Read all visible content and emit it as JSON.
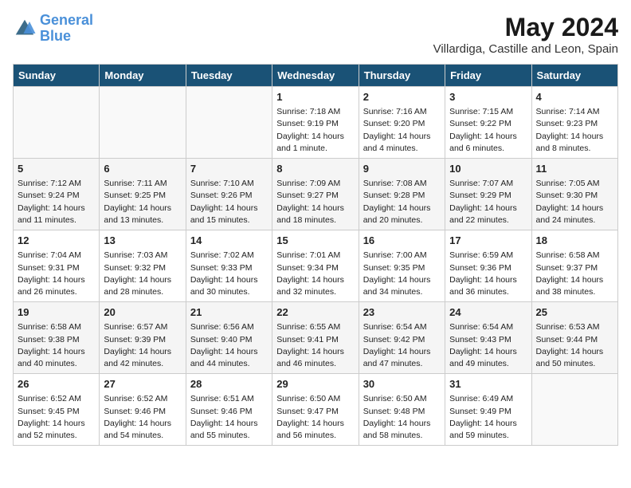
{
  "header": {
    "logo_line1": "General",
    "logo_line2": "Blue",
    "month": "May 2024",
    "location": "Villardiga, Castille and Leon, Spain"
  },
  "columns": [
    "Sunday",
    "Monday",
    "Tuesday",
    "Wednesday",
    "Thursday",
    "Friday",
    "Saturday"
  ],
  "weeks": [
    [
      {
        "day": "",
        "sunrise": "",
        "sunset": "",
        "daylight": ""
      },
      {
        "day": "",
        "sunrise": "",
        "sunset": "",
        "daylight": ""
      },
      {
        "day": "",
        "sunrise": "",
        "sunset": "",
        "daylight": ""
      },
      {
        "day": "1",
        "sunrise": "Sunrise: 7:18 AM",
        "sunset": "Sunset: 9:19 PM",
        "daylight": "Daylight: 14 hours and 1 minute."
      },
      {
        "day": "2",
        "sunrise": "Sunrise: 7:16 AM",
        "sunset": "Sunset: 9:20 PM",
        "daylight": "Daylight: 14 hours and 4 minutes."
      },
      {
        "day": "3",
        "sunrise": "Sunrise: 7:15 AM",
        "sunset": "Sunset: 9:22 PM",
        "daylight": "Daylight: 14 hours and 6 minutes."
      },
      {
        "day": "4",
        "sunrise": "Sunrise: 7:14 AM",
        "sunset": "Sunset: 9:23 PM",
        "daylight": "Daylight: 14 hours and 8 minutes."
      }
    ],
    [
      {
        "day": "5",
        "sunrise": "Sunrise: 7:12 AM",
        "sunset": "Sunset: 9:24 PM",
        "daylight": "Daylight: 14 hours and 11 minutes."
      },
      {
        "day": "6",
        "sunrise": "Sunrise: 7:11 AM",
        "sunset": "Sunset: 9:25 PM",
        "daylight": "Daylight: 14 hours and 13 minutes."
      },
      {
        "day": "7",
        "sunrise": "Sunrise: 7:10 AM",
        "sunset": "Sunset: 9:26 PM",
        "daylight": "Daylight: 14 hours and 15 minutes."
      },
      {
        "day": "8",
        "sunrise": "Sunrise: 7:09 AM",
        "sunset": "Sunset: 9:27 PM",
        "daylight": "Daylight: 14 hours and 18 minutes."
      },
      {
        "day": "9",
        "sunrise": "Sunrise: 7:08 AM",
        "sunset": "Sunset: 9:28 PM",
        "daylight": "Daylight: 14 hours and 20 minutes."
      },
      {
        "day": "10",
        "sunrise": "Sunrise: 7:07 AM",
        "sunset": "Sunset: 9:29 PM",
        "daylight": "Daylight: 14 hours and 22 minutes."
      },
      {
        "day": "11",
        "sunrise": "Sunrise: 7:05 AM",
        "sunset": "Sunset: 9:30 PM",
        "daylight": "Daylight: 14 hours and 24 minutes."
      }
    ],
    [
      {
        "day": "12",
        "sunrise": "Sunrise: 7:04 AM",
        "sunset": "Sunset: 9:31 PM",
        "daylight": "Daylight: 14 hours and 26 minutes."
      },
      {
        "day": "13",
        "sunrise": "Sunrise: 7:03 AM",
        "sunset": "Sunset: 9:32 PM",
        "daylight": "Daylight: 14 hours and 28 minutes."
      },
      {
        "day": "14",
        "sunrise": "Sunrise: 7:02 AM",
        "sunset": "Sunset: 9:33 PM",
        "daylight": "Daylight: 14 hours and 30 minutes."
      },
      {
        "day": "15",
        "sunrise": "Sunrise: 7:01 AM",
        "sunset": "Sunset: 9:34 PM",
        "daylight": "Daylight: 14 hours and 32 minutes."
      },
      {
        "day": "16",
        "sunrise": "Sunrise: 7:00 AM",
        "sunset": "Sunset: 9:35 PM",
        "daylight": "Daylight: 14 hours and 34 minutes."
      },
      {
        "day": "17",
        "sunrise": "Sunrise: 6:59 AM",
        "sunset": "Sunset: 9:36 PM",
        "daylight": "Daylight: 14 hours and 36 minutes."
      },
      {
        "day": "18",
        "sunrise": "Sunrise: 6:58 AM",
        "sunset": "Sunset: 9:37 PM",
        "daylight": "Daylight: 14 hours and 38 minutes."
      }
    ],
    [
      {
        "day": "19",
        "sunrise": "Sunrise: 6:58 AM",
        "sunset": "Sunset: 9:38 PM",
        "daylight": "Daylight: 14 hours and 40 minutes."
      },
      {
        "day": "20",
        "sunrise": "Sunrise: 6:57 AM",
        "sunset": "Sunset: 9:39 PM",
        "daylight": "Daylight: 14 hours and 42 minutes."
      },
      {
        "day": "21",
        "sunrise": "Sunrise: 6:56 AM",
        "sunset": "Sunset: 9:40 PM",
        "daylight": "Daylight: 14 hours and 44 minutes."
      },
      {
        "day": "22",
        "sunrise": "Sunrise: 6:55 AM",
        "sunset": "Sunset: 9:41 PM",
        "daylight": "Daylight: 14 hours and 46 minutes."
      },
      {
        "day": "23",
        "sunrise": "Sunrise: 6:54 AM",
        "sunset": "Sunset: 9:42 PM",
        "daylight": "Daylight: 14 hours and 47 minutes."
      },
      {
        "day": "24",
        "sunrise": "Sunrise: 6:54 AM",
        "sunset": "Sunset: 9:43 PM",
        "daylight": "Daylight: 14 hours and 49 minutes."
      },
      {
        "day": "25",
        "sunrise": "Sunrise: 6:53 AM",
        "sunset": "Sunset: 9:44 PM",
        "daylight": "Daylight: 14 hours and 50 minutes."
      }
    ],
    [
      {
        "day": "26",
        "sunrise": "Sunrise: 6:52 AM",
        "sunset": "Sunset: 9:45 PM",
        "daylight": "Daylight: 14 hours and 52 minutes."
      },
      {
        "day": "27",
        "sunrise": "Sunrise: 6:52 AM",
        "sunset": "Sunset: 9:46 PM",
        "daylight": "Daylight: 14 hours and 54 minutes."
      },
      {
        "day": "28",
        "sunrise": "Sunrise: 6:51 AM",
        "sunset": "Sunset: 9:46 PM",
        "daylight": "Daylight: 14 hours and 55 minutes."
      },
      {
        "day": "29",
        "sunrise": "Sunrise: 6:50 AM",
        "sunset": "Sunset: 9:47 PM",
        "daylight": "Daylight: 14 hours and 56 minutes."
      },
      {
        "day": "30",
        "sunrise": "Sunrise: 6:50 AM",
        "sunset": "Sunset: 9:48 PM",
        "daylight": "Daylight: 14 hours and 58 minutes."
      },
      {
        "day": "31",
        "sunrise": "Sunrise: 6:49 AM",
        "sunset": "Sunset: 9:49 PM",
        "daylight": "Daylight: 14 hours and 59 minutes."
      },
      {
        "day": "",
        "sunrise": "",
        "sunset": "",
        "daylight": ""
      }
    ]
  ]
}
